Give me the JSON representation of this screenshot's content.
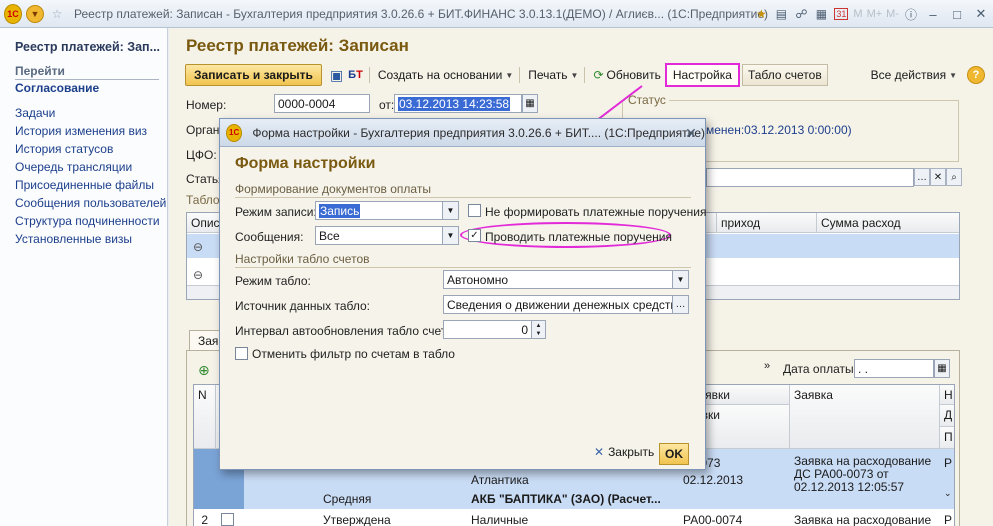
{
  "window": {
    "title": "Реестр платежей: Записан - Бухгалтерия предприятия 3.0.26.6 + БИТ.ФИНАНС 3.0.13.1(ДЕМО) / Аглиєв...  (1С:Предприятие)",
    "logo": "1С",
    "tool_m": "M",
    "tool_mplus": "M+",
    "tool_mminus": "M-",
    "calendar_day": "31"
  },
  "sidebar": {
    "title": "Реестр платежей: Зап...",
    "go_label": "Перейти",
    "approve_label": "Согласование",
    "items": [
      "Задачи",
      "История изменения виз",
      "История статусов",
      "Очередь трансляции",
      "Присоединенные файлы",
      "Сообщения пользователей",
      "Структура подчиненности",
      "Установленные визы"
    ]
  },
  "main": {
    "title": "Реестр платежей: Записан",
    "toolbar": {
      "save_close": "Записать и закрыть",
      "create_based": "Создать на основании",
      "print": "Печать",
      "refresh": "Обновить",
      "settings": "Настройка",
      "accounts_board": "Табло счетов",
      "all_actions": "Все действия",
      "help": "?"
    },
    "number_label": "Номер:",
    "number_value": "0000-0004",
    "date_from_label": "от:",
    "date_value": "03.12.2013 14:23:58",
    "org_label": "Орган",
    "cfo_label": "ЦФО:",
    "article_label": "Статья",
    "status_group": "Статус",
    "status_text": "менен:03.12.2013 0:00:00)",
    "table_label": "Табло",
    "grid1_headers": [
      "Опис",
      "",
      "приход",
      "Сумма расход"
    ],
    "tab1": "Зая",
    "payment_date_label": "Дата оплаты:",
    "payment_date_value": " .  .",
    "grid2_headers": [
      "N",
      "",
      "",
      "",
      "р заявки",
      "Заявка",
      "Н"
    ],
    "grid2_subheaders": [
      "заявки",
      "Д",
      "П"
    ],
    "rows": [
      {
        "col_a": "",
        "col_b": "Атлантика",
        "col_c": "0-0073",
        "col_d": "Заявка на расходование ДС РА00-0073 от 02.12.2013 12:05:57",
        "col_e": "Р"
      },
      {
        "col_a": "Средняя",
        "col_b": "АКБ \"БАПТИКА\" (ЗАО) (Расчет...",
        "col_c": "02.12.2013",
        "col_d": "",
        "col_e": ""
      },
      {
        "num": "2",
        "col_a": "Утверждена",
        "col_b": "Наличные",
        "col_c": "РА00-0074",
        "col_d": "Заявка на расходование",
        "col_e": "Р"
      }
    ]
  },
  "dialog": {
    "title": "Форма настройки - Бухгалтерия предприятия 3.0.26.6 + БИТ....  (1С:Предприятие)",
    "heading": "Форма настройки",
    "section1": "Формирование документов оплаты",
    "write_mode_label": "Режим записи:",
    "write_mode_value": "Запись",
    "no_orders_label": "Не формировать платежные поручения",
    "no_orders_checked": false,
    "messages_label": "Сообщения:",
    "messages_value": "Все",
    "post_orders_label": "Проводить платежные поручения",
    "post_orders_checked": true,
    "section2": "Настройки табло счетов",
    "board_mode_label": "Режим табло:",
    "board_mode_value": "Автономно",
    "board_source_label": "Источник данных табло:",
    "board_source_value": "Сведения о движении денежных средств",
    "interval_label": "Интервал автообновления табло счетов:",
    "interval_value": "0",
    "cancel_filter_label": "Отменить фильтр по счетам в табло",
    "cancel_filter_checked": false,
    "close_label": "Закрыть",
    "ok_label": "OK"
  },
  "colors": {
    "accent_highlight": "#e22ad9",
    "title_text": "#7a5a10",
    "link": "#1c3f8c",
    "selected_row": "#c9dcf5"
  }
}
